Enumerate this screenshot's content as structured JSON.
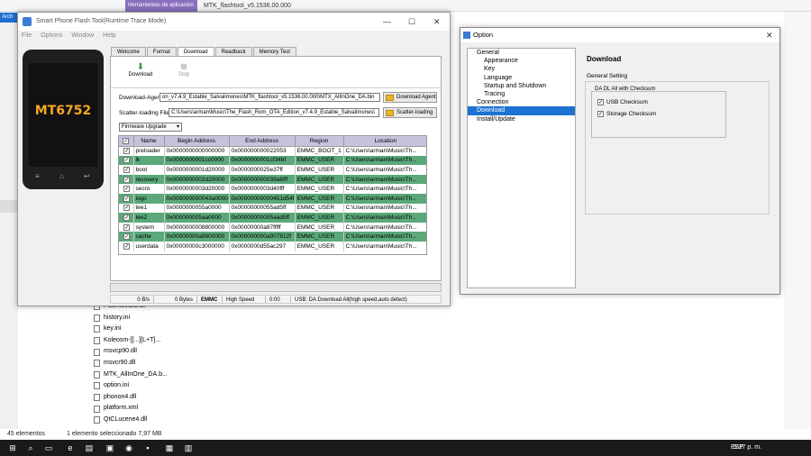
{
  "explorer": {
    "ribbon_tab": "Herramientas de aplicación",
    "ribbon_title": "MTK_flashtool_v5.1536.00.000",
    "arch_label": "Arch",
    "files": [
      "FlashtoolLib.dll",
      "history.ini",
      "key.ini",
      "Koleosm-[[...][L+T]...",
      "msvcp90.dll",
      "msvcr90.dll",
      "MTK_AllInOne_DA.b...",
      "option.ini",
      "phonon4.dll",
      "platform.xml",
      "QtCLucene4.dll"
    ],
    "status_count": "45 elementos",
    "status_selected": "1 elemento seleccionado  7,97 MB"
  },
  "taskbar": {
    "lang": "ESP",
    "time": "5:27 p. m."
  },
  "sp": {
    "title": "Smart Phone Flash Tool(Runtime Trace Mode)",
    "menu": [
      "File",
      "Options",
      "Window",
      "Help"
    ],
    "phone_brand": "MT6752",
    "tabs": [
      "Welcome",
      "Format",
      "Download",
      "Readback",
      "Memory Test"
    ],
    "download_btn": "Download",
    "stop_btn": "Stop",
    "da_label": "Download-Agent",
    "da_value": "on_v7.4.9_Estable_Salvalimones\\MTK_flashtool_v5.1536.00.000\\MTX_AllInOne_DA.bin",
    "da_button": "Download Agent",
    "scatter_label": "Scatter-loading File",
    "scatter_value": "C:\\Users\\arman\\Music\\The_Flash_Rom_OTA_Edition_v7.4.9_Estable_Salvalimones\\",
    "scatter_button": "Scatter-loading",
    "mode": "Firmware Upgrade",
    "columns": [
      "Name",
      "Begin Address",
      "End Address",
      "Region",
      "Location"
    ],
    "rows": [
      {
        "name": "preloader",
        "begin": "0x0000000000000000",
        "end": "0x000000000022053",
        "region": "EMMC_BOOT_1",
        "loc": "C:\\Users\\arman\\Music\\Th..."
      },
      {
        "name": "lk",
        "begin": "0x0000000001cc0000",
        "end": "0x0000000001cf34bf",
        "region": "EMMC_USER",
        "loc": "C:\\Users\\arman\\Music\\Th..."
      },
      {
        "name": "boot",
        "begin": "0x0000000001d20000",
        "end": "0x0000000025e37ff",
        "region": "EMMC_USER",
        "loc": "C:\\Users\\arman\\Music\\Th..."
      },
      {
        "name": "recovery",
        "begin": "0x0000000002d20000",
        "end": "0x000000000039a6fff",
        "region": "EMMC_USER",
        "loc": "C:\\Users\\arman\\Music\\Th..."
      },
      {
        "name": "secro",
        "begin": "0x0000000003d20000",
        "end": "0x0000000003d40fff",
        "region": "EMMC_USER",
        "loc": "C:\\Users\\arman\\Music\\Th..."
      },
      {
        "name": "logo",
        "begin": "0x000000000043a0000",
        "end": "0x00000000000451d54f",
        "region": "EMMC_USER",
        "loc": "C:\\Users\\arman\\Music\\Th..."
      },
      {
        "name": "tee1",
        "begin": "0x0000000055a0000",
        "end": "0x00000000055ad5ff",
        "region": "EMMC_USER",
        "loc": "C:\\Users\\arman\\Music\\Th..."
      },
      {
        "name": "tee2",
        "begin": "0x000000005aa0000",
        "end": "0x00000000005aad5ff",
        "region": "EMMC_USER",
        "loc": "C:\\Users\\arman\\Music\\Th..."
      },
      {
        "name": "system",
        "begin": "0x0000000008800000",
        "end": "0x00000000a87fffff",
        "region": "EMMC_USER",
        "loc": "C:\\Users\\arman\\Music\\Th..."
      },
      {
        "name": "cache",
        "begin": "0x00000000a8800000",
        "end": "0x000000000a907812f",
        "region": "EMMC_USER",
        "loc": "C:\\Users\\arman\\Music\\Th..."
      },
      {
        "name": "userdata",
        "begin": "0x00000000c3000000",
        "end": "0x0000000d55ac297",
        "region": "EMMC_USER",
        "loc": "C:\\Users\\arman\\Music\\Th..."
      }
    ],
    "status": {
      "speed": "0 B/s",
      "bytes": "0 Bytes",
      "storage": "EMMC",
      "mode": "High Speed",
      "time": "0:00",
      "msg": "USB: DA Download All(high speed,auto detect)"
    }
  },
  "opt": {
    "title": "Option",
    "tree": [
      {
        "label": "General",
        "level": 0
      },
      {
        "label": "Appearance",
        "level": 1
      },
      {
        "label": "Key",
        "level": 1
      },
      {
        "label": "Language",
        "level": 1
      },
      {
        "label": "Startup and Shutdown",
        "level": 1
      },
      {
        "label": "Tracing",
        "level": 1
      },
      {
        "label": "Connection",
        "level": 0
      },
      {
        "label": "Download",
        "level": 0,
        "selected": true
      },
      {
        "label": "Install/Update",
        "level": 0
      }
    ],
    "heading": "Download",
    "general_setting": "General Setting",
    "da_group": "DA DL All with Checksum",
    "usb_checksum": "USB Checksum",
    "storage_checksum": "Storage Checksum"
  }
}
